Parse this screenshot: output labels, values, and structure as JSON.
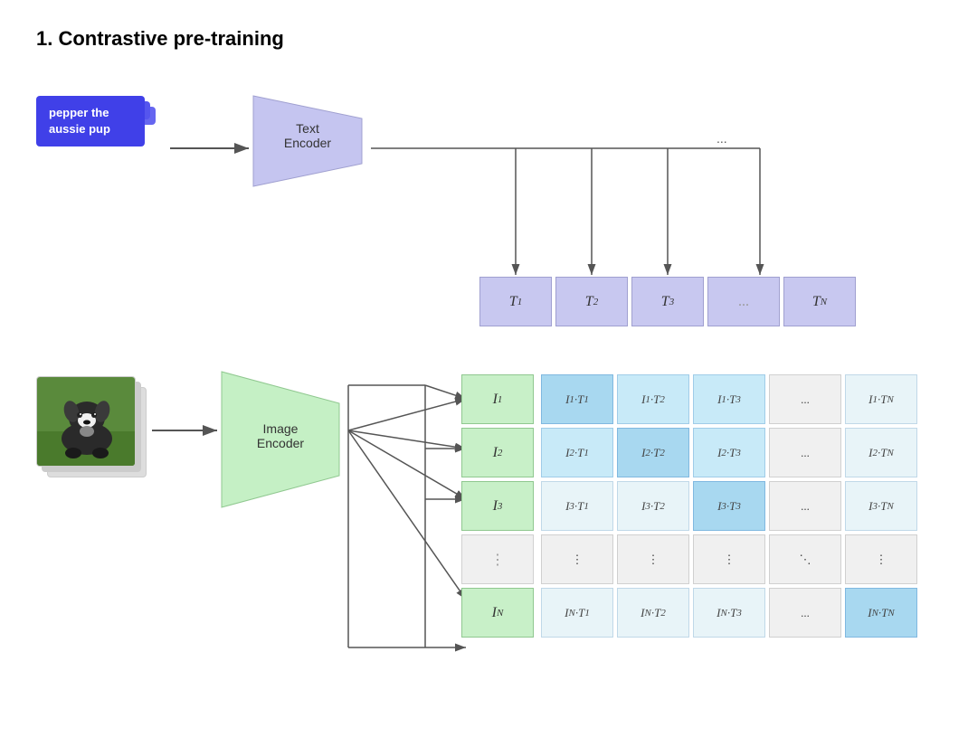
{
  "title": "1. Contrastive pre-training",
  "text_input": {
    "lines": [
      "pepper the",
      "aussie pup"
    ],
    "label": "pepper the aussie pup"
  },
  "text_encoder": {
    "label": "Text\nEncoder"
  },
  "image_encoder": {
    "label": "Image\nEncoder"
  },
  "t_vectors": [
    "T₁",
    "T₂",
    "T₃",
    "...",
    "Tₙ"
  ],
  "i_vectors": [
    "I₁",
    "I₂",
    "I₃",
    "⋮",
    "Iₙ"
  ],
  "matrix": {
    "rows": [
      [
        "I₁·T₁",
        "I₁·T₂",
        "I₁·T₃",
        "...",
        "I₁·Tₙ"
      ],
      [
        "I₂·T₁",
        "I₂·T₂",
        "I₂·T₃",
        "...",
        "I₂·Tₙ"
      ],
      [
        "I₃·T₁",
        "I₃·T₂",
        "I₃·T₃",
        "...",
        "I₃·Tₙ"
      ],
      [
        "⋮",
        "⋮",
        "⋮",
        "⋱",
        "⋮"
      ],
      [
        "Iₙ·T₁",
        "Iₙ·T₂",
        "Iₙ·T₃",
        "...",
        "Iₙ·Tₙ"
      ]
    ],
    "diagonal_highlight": [
      [
        0,
        0
      ],
      [
        1,
        1
      ],
      [
        2,
        2
      ],
      [
        4,
        4
      ]
    ],
    "secondary_highlight": [
      [
        0,
        1
      ],
      [
        1,
        0
      ],
      [
        1,
        2
      ],
      [
        2,
        1
      ],
      [
        0,
        2
      ]
    ]
  },
  "colors": {
    "text_card": "#4040e8",
    "text_encoder": "#c5c5f0",
    "image_encoder": "#c5f0c5",
    "t_vector": "#c8c8f0",
    "i_vector": "#c8f0c8",
    "matrix_default": "#e8f4f8",
    "matrix_highlight": "#a8d8f0",
    "matrix_light": "#c8eaf8"
  }
}
